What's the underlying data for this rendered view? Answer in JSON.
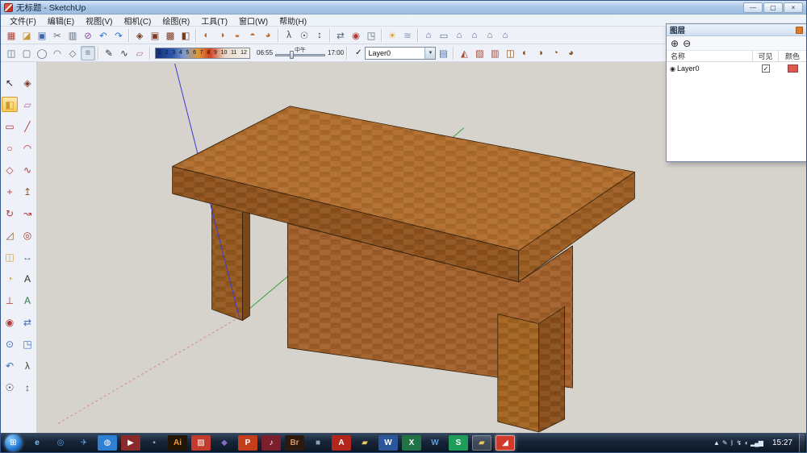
{
  "window": {
    "title": "无标题 - SketchUp",
    "min": "—",
    "max": "▢",
    "close": "×"
  },
  "menubar": [
    "文件(F)",
    "编辑(E)",
    "视图(V)",
    "相机(C)",
    "绘图(R)",
    "工具(T)",
    "窗口(W)",
    "帮助(H)"
  ],
  "toolbar_main": {
    "g1": [
      {
        "n": "model-info",
        "g": "▦",
        "c": "#b23b2e"
      },
      {
        "n": "open",
        "g": "◪",
        "c": "#c9973b"
      },
      {
        "n": "save",
        "g": "▣",
        "c": "#3f67a8"
      },
      {
        "n": "cut",
        "g": "✂",
        "c": "#5a6b7c"
      },
      {
        "n": "copy",
        "g": "▥",
        "c": "#5a6b7c"
      },
      {
        "n": "erase",
        "g": "⊘",
        "c": "#8a4a9a"
      },
      {
        "n": "undo",
        "g": "↶",
        "c": "#2f6fd0"
      },
      {
        "n": "redo",
        "g": "↷",
        "c": "#2f6fd0"
      }
    ],
    "g2": [
      {
        "n": "make-component",
        "g": "◈",
        "c": "#7a3b22"
      },
      {
        "n": "make-group",
        "g": "▣",
        "c": "#7a3b22"
      },
      {
        "n": "intersect",
        "g": "▩",
        "c": "#7a3b22"
      },
      {
        "n": "outer-shell",
        "g": "◧",
        "c": "#7a3b22"
      }
    ],
    "g3": [
      {
        "n": "solid-union",
        "g": "◐",
        "c": "#c06a2a"
      },
      {
        "n": "solid-subtract",
        "g": "◑",
        "c": "#c06a2a"
      },
      {
        "n": "solid-trim",
        "g": "◒",
        "c": "#c06a2a"
      },
      {
        "n": "solid-split",
        "g": "◓",
        "c": "#c06a2a"
      },
      {
        "n": "solid-shell",
        "g": "◕",
        "c": "#c06a2a"
      }
    ],
    "g4": [
      {
        "n": "walk",
        "g": "λ",
        "c": "#444444"
      },
      {
        "n": "look-around",
        "g": "☉",
        "c": "#444444"
      },
      {
        "n": "position-camera",
        "g": "↕",
        "c": "#444444"
      }
    ],
    "g5": [
      {
        "n": "pan",
        "g": "⇄",
        "c": "#556677"
      },
      {
        "n": "orbit",
        "g": "◉",
        "c": "#b03a3a"
      },
      {
        "n": "zoom-window",
        "g": "◳",
        "c": "#556677"
      }
    ],
    "g6": [
      {
        "n": "shadows",
        "g": "☀",
        "c": "#d8a02a"
      },
      {
        "n": "fog",
        "g": "≋",
        "c": "#8899bb"
      }
    ],
    "g7": [
      {
        "n": "iso-view",
        "g": "⌂",
        "c": "#55688a"
      },
      {
        "n": "top-view",
        "g": "▭",
        "c": "#55688a"
      },
      {
        "n": "front-view",
        "g": "⌂",
        "c": "#55688a"
      },
      {
        "n": "right-view",
        "g": "⌂",
        "c": "#55688a"
      },
      {
        "n": "back-view",
        "g": "⌂",
        "c": "#55688a"
      },
      {
        "n": "left-view",
        "g": "⌂",
        "c": "#55688a"
      }
    ]
  },
  "toolbar_second": {
    "shapes": [
      {
        "n": "draw-box",
        "g": "◫",
        "c": "#5a6b7c"
      },
      {
        "n": "draw-rect",
        "g": "▢",
        "c": "#5a6b7c"
      },
      {
        "n": "draw-circle",
        "g": "◯",
        "c": "#5a6b7c"
      },
      {
        "n": "draw-arc",
        "g": "◠",
        "c": "#5a6b7c"
      },
      {
        "n": "draw-polygon",
        "g": "◇",
        "c": "#5a6b7c"
      },
      {
        "n": "draw-lines",
        "g": "≡",
        "c": "#5a6b7c",
        "active": true
      }
    ],
    "draw": [
      {
        "n": "pencil",
        "g": "✎",
        "c": "#333333"
      },
      {
        "n": "freehand",
        "g": "∿",
        "c": "#333333"
      },
      {
        "n": "eraser",
        "g": "▱",
        "c": "#c06a9a"
      }
    ],
    "month_strip": {
      "numbers": [
        "1",
        "2",
        "3",
        "4",
        "5",
        "6",
        "7",
        "8",
        "9",
        "10",
        "11",
        "12"
      ]
    },
    "time_slider": {
      "start": "06:55",
      "noon": "中午",
      "end": "17:00"
    },
    "layer_check": "✓",
    "layer_combo": {
      "value": "Layer0",
      "arrow": "▼"
    },
    "layer_manager": {
      "n": "layer-manager",
      "g": "▤",
      "c": "#3f67a8"
    },
    "right1": [
      {
        "n": "section-plane",
        "g": "◭",
        "c": "#a04a3a"
      },
      {
        "n": "section-display",
        "g": "▨",
        "c": "#a04a3a"
      },
      {
        "n": "section-cut",
        "g": "▥",
        "c": "#a04a3a"
      },
      {
        "n": "back-edges",
        "g": "◫",
        "c": "#8a4f1e"
      }
    ],
    "right2": [
      {
        "n": "shadow-dialog",
        "g": "◐",
        "c": "#8a4f1e"
      },
      {
        "n": "fog-dialog",
        "g": "◑",
        "c": "#8a4f1e"
      },
      {
        "n": "match-photo",
        "g": "◔",
        "c": "#8a4f1e"
      },
      {
        "n": "soften-edges",
        "g": "◕",
        "c": "#8a4f1e"
      }
    ]
  },
  "left_toolbar": [
    {
      "n": "select",
      "g": "↖",
      "c": "#222222"
    },
    {
      "n": "make-component",
      "g": "◈",
      "c": "#7a3b22"
    },
    {
      "n": "paint-bucket",
      "g": "◧",
      "c": "#d09a2b",
      "active": true
    },
    {
      "n": "eraser",
      "g": "▱",
      "c": "#c06a9a"
    },
    {
      "n": "rectangle",
      "g": "▭",
      "c": "#b03a3a"
    },
    {
      "n": "line",
      "g": "╱",
      "c": "#b03a3a"
    },
    {
      "n": "circle",
      "g": "○",
      "c": "#b03a3a"
    },
    {
      "n": "arc",
      "g": "◠",
      "c": "#b03a3a"
    },
    {
      "n": "polygon",
      "g": "◇",
      "c": "#b03a3a"
    },
    {
      "n": "freehand",
      "g": "∿",
      "c": "#b03a3a"
    },
    {
      "n": "move",
      "g": "+",
      "c": "#b03a3a"
    },
    {
      "n": "push-pull",
      "g": "↥",
      "c": "#8a5a2a"
    },
    {
      "n": "rotate",
      "g": "↻",
      "c": "#b03a3a"
    },
    {
      "n": "follow-me",
      "g": "↝",
      "c": "#b03a3a"
    },
    {
      "n": "scale",
      "g": "◿",
      "c": "#8a5a2a"
    },
    {
      "n": "offset",
      "g": "◎",
      "c": "#b03a3a"
    },
    {
      "n": "tape-measure",
      "g": "◫",
      "c": "#c8a23a"
    },
    {
      "n": "dimension",
      "g": "↔",
      "c": "#556688"
    },
    {
      "n": "protractor",
      "g": "◔",
      "c": "#c8a23a"
    },
    {
      "n": "text",
      "g": "A",
      "c": "#333333"
    },
    {
      "n": "axes",
      "g": "⊥",
      "c": "#b03a3a"
    },
    {
      "n": "3d-text",
      "g": "A",
      "c": "#2a7a4a"
    },
    {
      "n": "orbit",
      "g": "◉",
      "c": "#b03a3a"
    },
    {
      "n": "pan",
      "g": "⇄",
      "c": "#3a6ac0"
    },
    {
      "n": "zoom",
      "g": "⊙",
      "c": "#3a6ac0"
    },
    {
      "n": "zoom-extents",
      "g": "◳",
      "c": "#3a6ac0"
    },
    {
      "n": "zoom-previous",
      "g": "↶",
      "c": "#3a6ac0"
    },
    {
      "n": "walk",
      "g": "λ",
      "c": "#444444"
    },
    {
      "n": "look-around",
      "g": "☉",
      "c": "#444444"
    },
    {
      "n": "position-camera",
      "g": "↕",
      "c": "#444444"
    }
  ],
  "layers_panel": {
    "title": "图层",
    "add_icon": "⊕",
    "remove_icon": "⊖",
    "columns": [
      "名称",
      "可见",
      "颜色"
    ],
    "rows": [
      {
        "name": "Layer0",
        "radio": "◉",
        "check": "✓",
        "visible": true,
        "color": "#e2574c"
      }
    ]
  },
  "canvas": {
    "background": "#d6d3cd",
    "axis_colors": {
      "blue": "#3a3ad8",
      "green": "#3aa23a",
      "red": "#d88a8a"
    },
    "model": "wooden-table"
  },
  "taskbar": {
    "start_glyph": "⊞",
    "apps": [
      {
        "n": "internet-explorer",
        "g": "e",
        "c": "#7ec0f0"
      },
      {
        "n": "browser",
        "g": "◎",
        "c": "#5aa0e0"
      },
      {
        "n": "mail",
        "g": "✈",
        "c": "#5aa0e0"
      },
      {
        "n": "compass-browser",
        "g": "◍",
        "c": "#ffffff",
        "bg": "#2f7fd4"
      },
      {
        "n": "media-player",
        "g": "▶",
        "c": "#ffffff",
        "bg": "#8a2a2a"
      },
      {
        "n": "dark-app",
        "g": "▪",
        "c": "#99a6b8"
      },
      {
        "n": "illustrator",
        "g": "Ai",
        "c": "#ff9a2a",
        "bg": "#231505"
      },
      {
        "n": "red-app",
        "g": "▨",
        "c": "#ffffff",
        "bg": "#c23b2d"
      },
      {
        "n": "dev-tool",
        "g": "◆",
        "c": "#8a6ac8"
      },
      {
        "n": "powerpoint",
        "g": "P",
        "c": "#ffffff",
        "bg": "#c43e1c"
      },
      {
        "n": "music-app",
        "g": "♪",
        "c": "#ffffff",
        "bg": "#7a1f2b"
      },
      {
        "n": "bridge",
        "g": "Br",
        "c": "#d8925a",
        "bg": "#2a1a10"
      },
      {
        "n": "gray-app",
        "g": "■",
        "c": "#8fa0b5"
      },
      {
        "n": "acrobat",
        "g": "A",
        "c": "#ffffff",
        "bg": "#b3261e"
      },
      {
        "n": "folder",
        "g": "▰",
        "c": "#eac65e"
      },
      {
        "n": "word",
        "g": "W",
        "c": "#ffffff",
        "bg": "#2b579a"
      },
      {
        "n": "excel",
        "g": "X",
        "c": "#ffffff",
        "bg": "#217346"
      },
      {
        "n": "word-viewer",
        "g": "W",
        "c": "#5aa0e0"
      },
      {
        "n": "stretch-app",
        "g": "S",
        "c": "#ffffff",
        "bg": "#1e9e5a"
      },
      {
        "n": "control-folder",
        "g": "▰",
        "c": "#eac65e",
        "hl": true
      },
      {
        "n": "sketchup",
        "g": "◢",
        "c": "#ffffff",
        "bg": "#d03a2a",
        "active": true
      }
    ],
    "tray": [
      {
        "n": "show-hidden",
        "g": "▲"
      },
      {
        "n": "pen-input",
        "g": "✎"
      },
      {
        "n": "bluetooth",
        "g": "ᛒ"
      },
      {
        "n": "power",
        "g": "↯"
      },
      {
        "n": "volume",
        "g": "◖"
      },
      {
        "n": "network",
        "g": "▂▄▆"
      }
    ],
    "clock": "15:27"
  }
}
